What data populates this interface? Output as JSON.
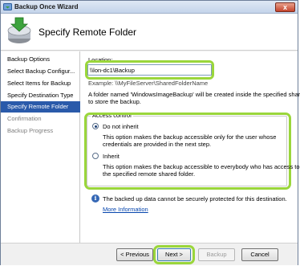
{
  "window": {
    "title": "Backup Once Wizard",
    "close_label": "x"
  },
  "header": {
    "title": "Specify Remote Folder"
  },
  "sidebar": {
    "items": [
      {
        "label": "Backup Options",
        "state": "normal"
      },
      {
        "label": "Select Backup Configur...",
        "state": "normal"
      },
      {
        "label": "Select Items for Backup",
        "state": "normal"
      },
      {
        "label": "Specify Destination Type",
        "state": "normal"
      },
      {
        "label": "Specify Remote Folder",
        "state": "active"
      },
      {
        "label": "Confirmation",
        "state": "disabled"
      },
      {
        "label": "Backup Progress",
        "state": "disabled"
      }
    ]
  },
  "location": {
    "label": "Location:",
    "value": "\\\\lon-dc1\\Backup",
    "example": "Example: \\\\MyFileServer\\SharedFolderName",
    "note_line1": "A folder named 'WindowsImageBackup' will be created inside the specified share",
    "note_line2": "to store the backup."
  },
  "access_control": {
    "title": "Access control",
    "options": [
      {
        "label": "Do not inherit",
        "selected": true,
        "desc_line1": "This option makes the backup accessible only for the user whose",
        "desc_line2": "credentials are provided in the next step."
      },
      {
        "label": "Inherit",
        "selected": false,
        "desc_line1": "This option makes the backup accessible to everybody who has access to",
        "desc_line2": "the specified remote shared folder."
      }
    ]
  },
  "info": {
    "icon": "info-icon",
    "text": "The backed up data cannot be securely protected for this destination.",
    "link": "More Information"
  },
  "buttons": {
    "previous": "< Previous",
    "next": "Next >",
    "backup": "Backup",
    "cancel": "Cancel"
  },
  "colors": {
    "highlight": "#9ad63b",
    "active_nav": "#2a5aaa"
  }
}
